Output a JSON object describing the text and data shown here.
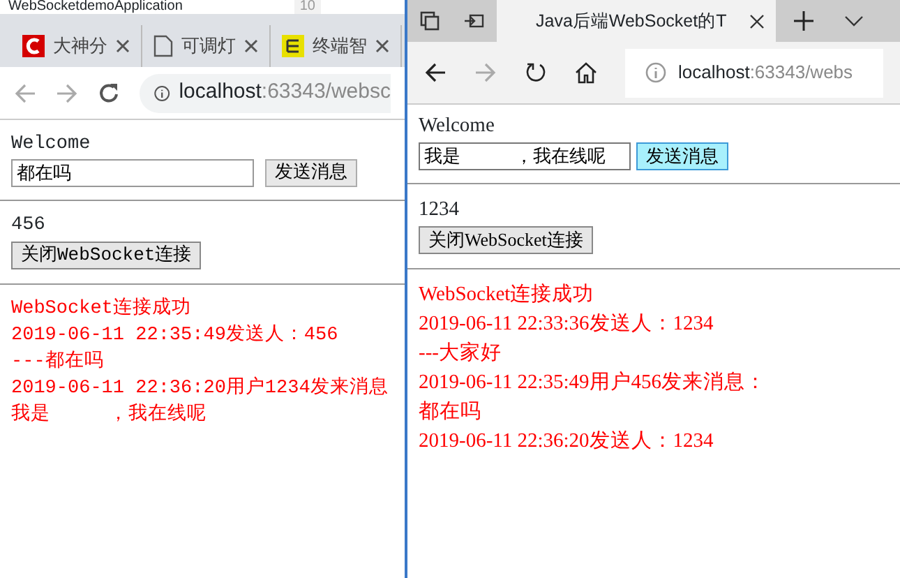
{
  "background_window": {
    "title": "WebSocketdemoApplication",
    "line_number": "10"
  },
  "windows": [
    {
      "kind": "chrome",
      "tabs": [
        {
          "label": "大神分",
          "kind": "brand"
        },
        {
          "label": "可调灯",
          "kind": "document"
        },
        {
          "label": "终端智",
          "kind": "yellow"
        }
      ],
      "address": {
        "host": "localhost",
        "path": ":63343/websc"
      },
      "page": {
        "welcome": "Welcome",
        "input_value": "都在吗",
        "send_button": {
          "label": "发送消息",
          "hovered": false
        },
        "user_id": "456",
        "close_button": "关闭WebSocket连接",
        "messages": [
          "WebSocket连接成功",
          "2019-06-11 22:35:49发送人：456",
          "---都在吗",
          "2019-06-11 22:36:20用户1234发来消息",
          "我是　　　，我在线呢"
        ]
      }
    },
    {
      "kind": "edge",
      "tabs": [
        {
          "label": "Java后端WebSocket的T",
          "kind": "page"
        }
      ],
      "address": {
        "host": "localhost",
        "path": ":63343/webs"
      },
      "page": {
        "welcome": "Welcome",
        "input_value": "我是　　　，我在线呢",
        "send_button": {
          "label": "发送消息",
          "hovered": true
        },
        "user_id": "1234",
        "close_button": "关闭WebSocket连接",
        "messages": [
          "WebSocket连接成功",
          "2019-06-11 22:33:36发送人：1234",
          "---大家好",
          "2019-06-11 22:35:49用户456发来消息：",
          "都在吗",
          "2019-06-11 22:36:20发送人：1234"
        ]
      }
    }
  ]
}
